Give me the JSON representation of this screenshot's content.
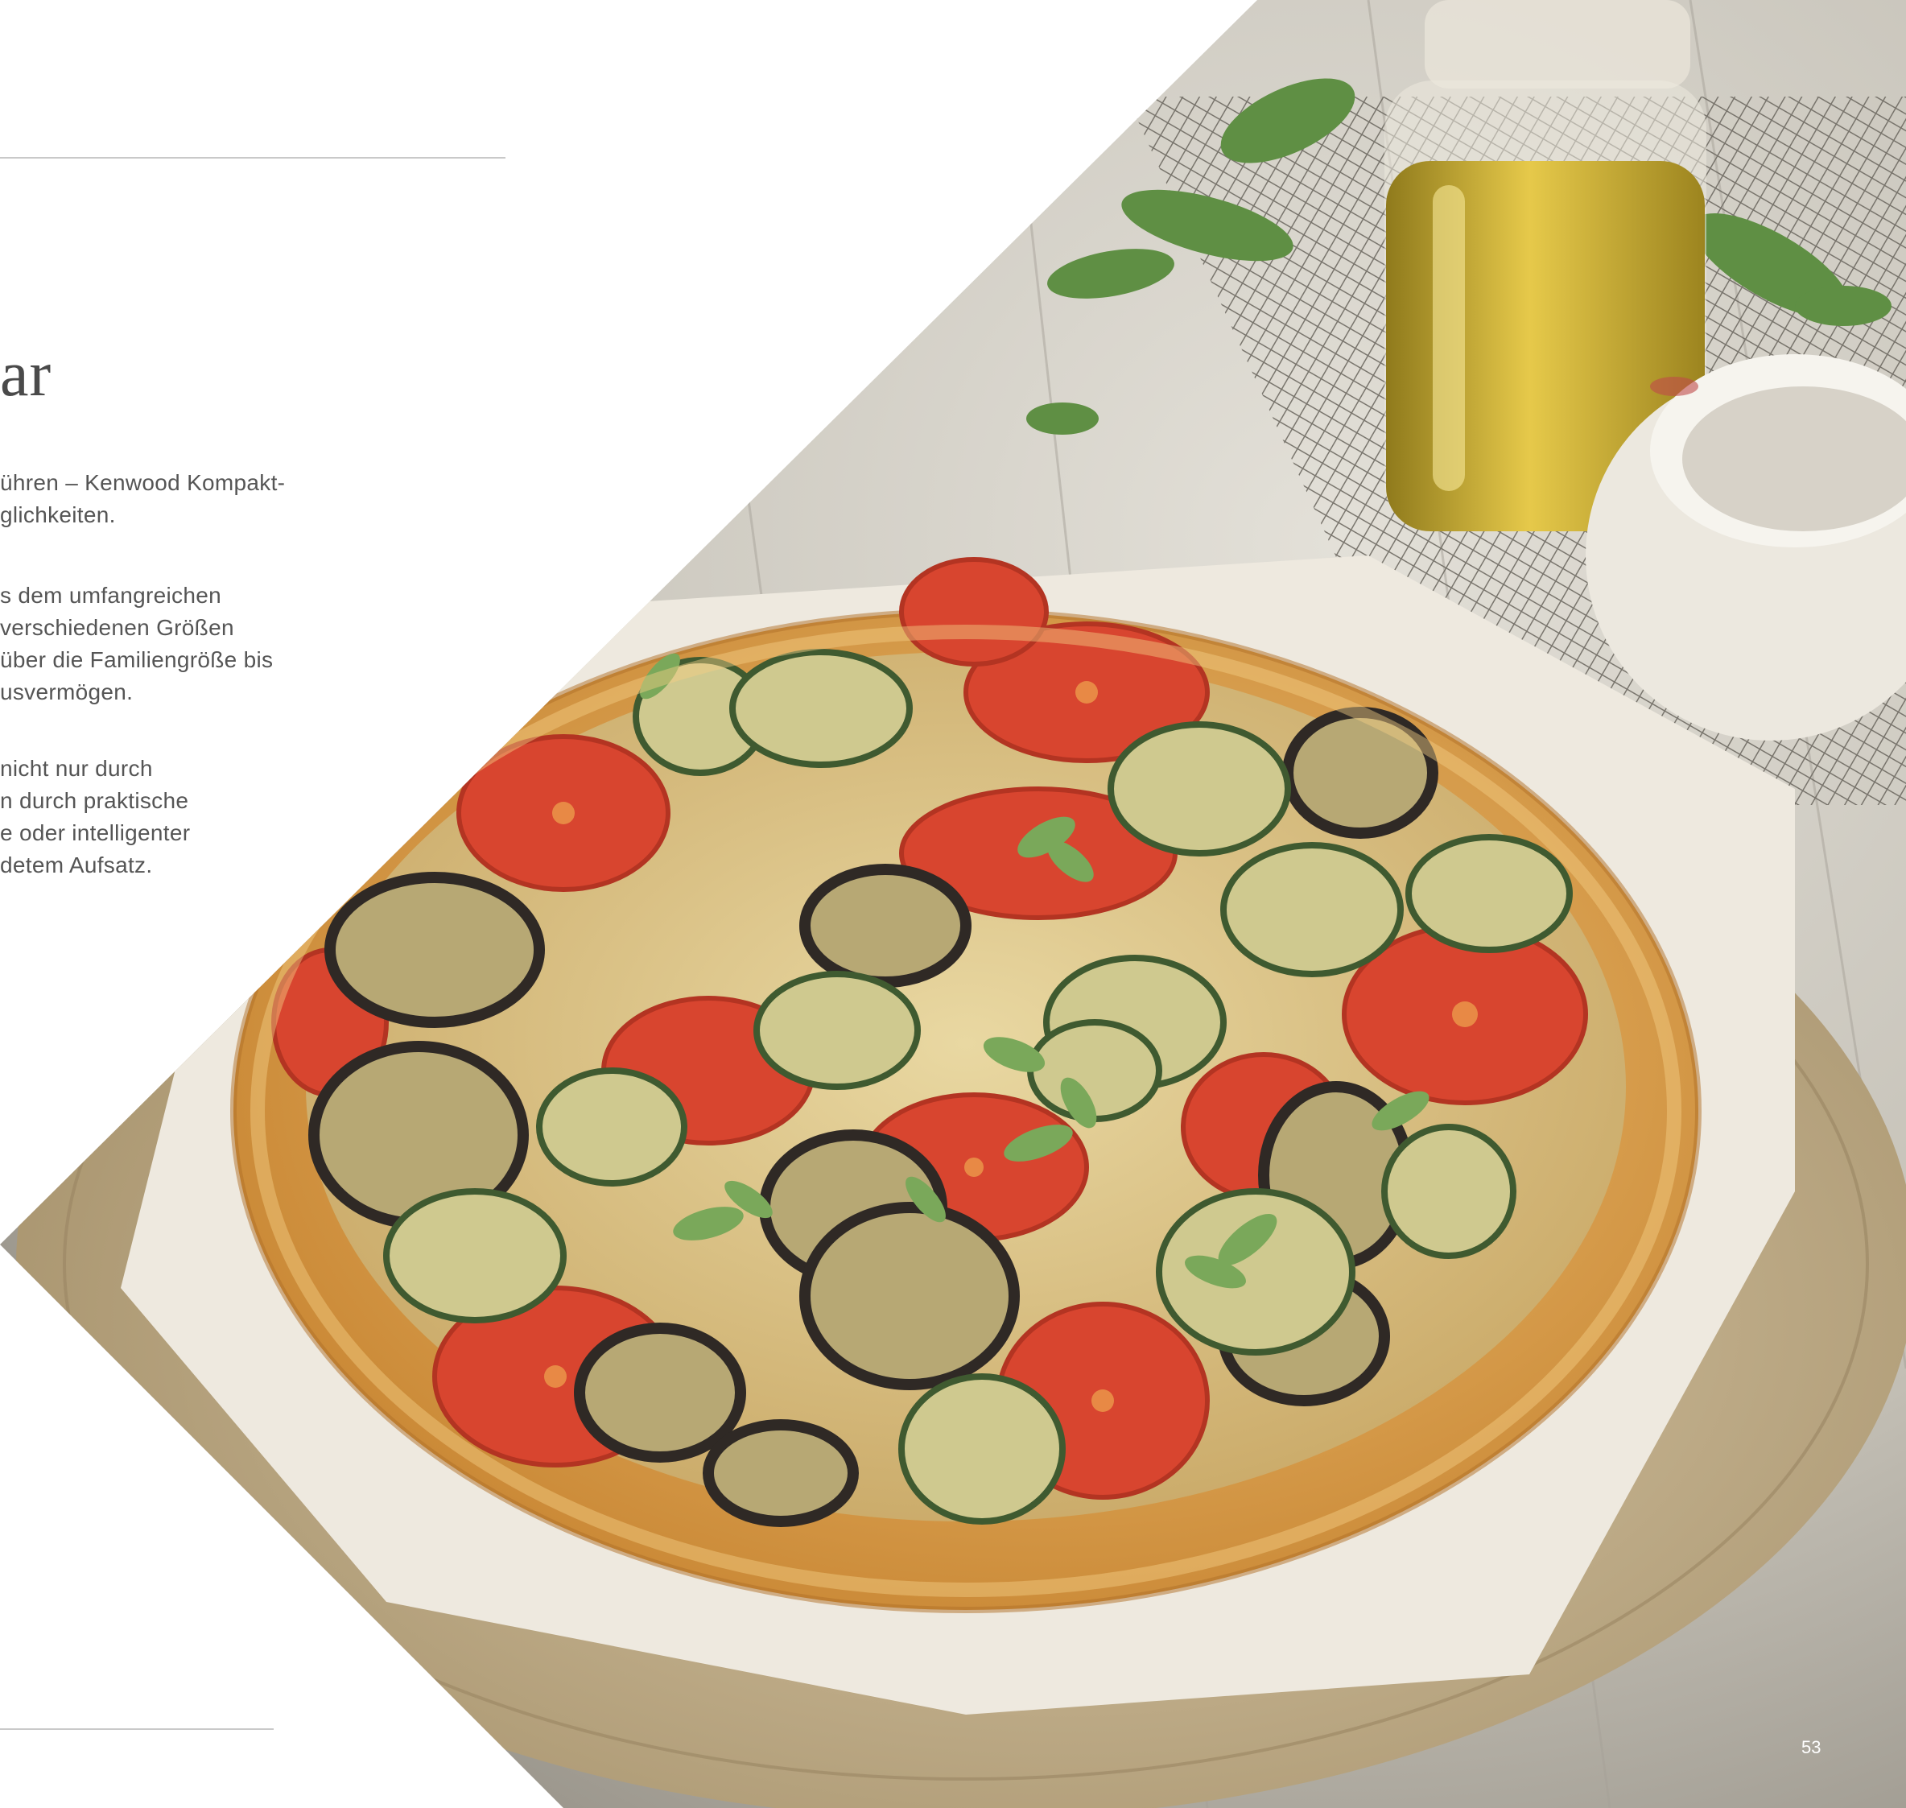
{
  "page": {
    "heading_fragment": "ar",
    "paragraphs": [
      [
        "ühren – Kenwood Kompakt-",
        "glichkeiten."
      ],
      [
        "s dem umfangreichen",
        "verschiedenen Größen",
        "über die Familiengröße bis",
        "usvermögen."
      ],
      [
        "nicht nur durch",
        "n durch praktische",
        "e oder intelligenter",
        "detem Aufsatz."
      ]
    ],
    "page_number": "53"
  },
  "colors": {
    "text": "#555555",
    "heading": "#4a4a4a",
    "rule": "#c9c9c9",
    "crust": "#d9a24a",
    "tomato": "#d8452f",
    "zucchini": "#a9a965",
    "eggplant": "#3b3530",
    "herb": "#6f9a52",
    "oil": "#c9a826",
    "table": "#b9b6ae"
  },
  "photo": {
    "subject": "vegetable-tart-on-wooden-board"
  }
}
